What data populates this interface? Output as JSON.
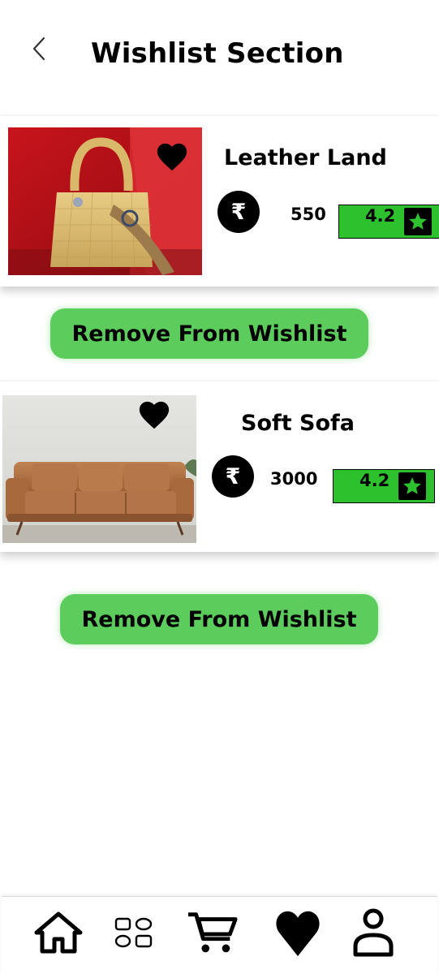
{
  "header": {
    "title": "Wishlist Section",
    "back_icon": "chevron-left-icon"
  },
  "items": [
    {
      "name": "Leather Land",
      "currency_symbol": "₹",
      "price": "550",
      "rating": "4.2",
      "image": "handbag-photo",
      "remove_label": "Remove From Wishlist"
    },
    {
      "name": "Soft Sofa",
      "currency_symbol": "₹",
      "price": "3000",
      "rating": "4.2",
      "image": "sofa-photo",
      "remove_label": "Remove From Wishlist"
    }
  ],
  "bottom_nav": {
    "items": [
      {
        "icon": "home-icon"
      },
      {
        "icon": "categories-icon"
      },
      {
        "icon": "cart-icon"
      },
      {
        "icon": "heart-icon"
      },
      {
        "icon": "profile-icon"
      }
    ]
  },
  "colors": {
    "rating_bg": "#2ec12e",
    "button_bg": "#5ccd5c",
    "text": "#000000",
    "background": "#ffffff"
  }
}
